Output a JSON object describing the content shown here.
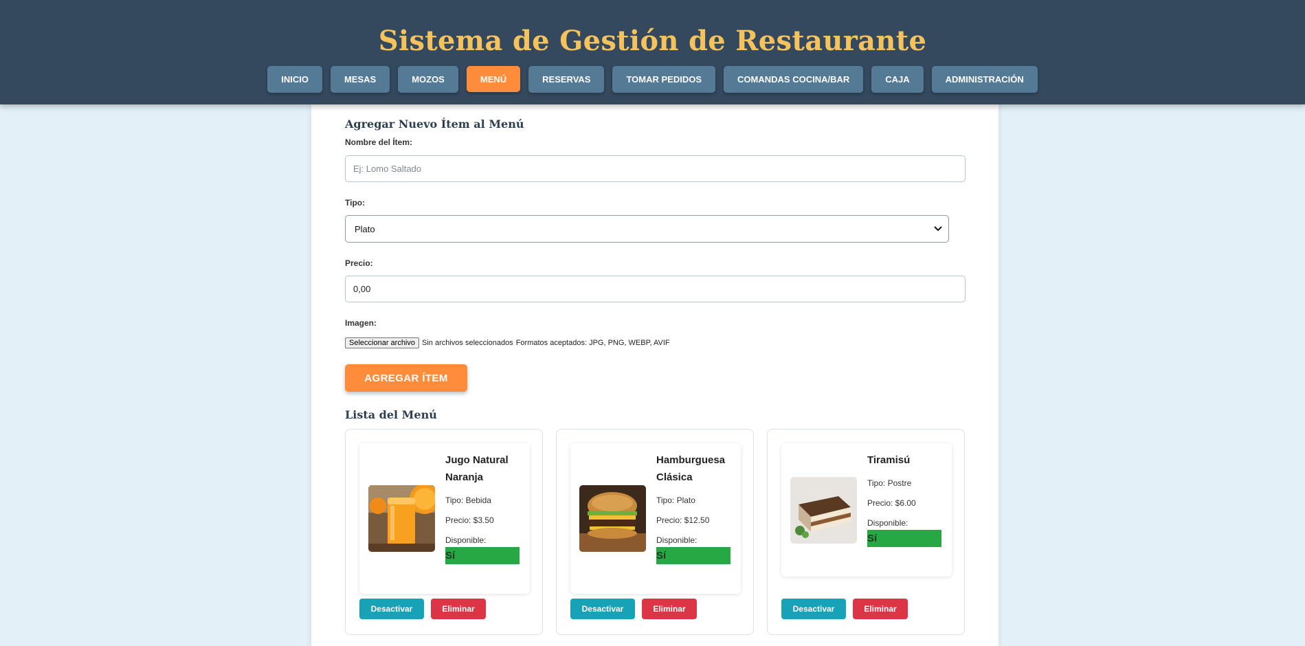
{
  "app": {
    "title": "Sistema de Gestión de Restaurante"
  },
  "nav": {
    "items": [
      {
        "label": "INICIO"
      },
      {
        "label": "MESAS"
      },
      {
        "label": "MOZOS"
      },
      {
        "label": "MENÚ",
        "active": true
      },
      {
        "label": "RESERVAS"
      },
      {
        "label": "TOMAR PEDIDOS"
      },
      {
        "label": "COMANDAS COCINA/BAR"
      },
      {
        "label": "CAJA"
      },
      {
        "label": "ADMINISTRACIÓN"
      }
    ]
  },
  "form": {
    "title": "Agregar Nuevo Ítem al Menú",
    "name_label": "Nombre del Ítem:",
    "name_placeholder": "Ej: Lomo Saltado",
    "type_label": "Tipo:",
    "type_value": "Plato",
    "price_label": "Precio:",
    "price_value": "0,00",
    "image_label": "Imagen:",
    "file_button": "Seleccionar archivo",
    "file_status": "Sin archivos seleccionados",
    "file_formats": "Formatos aceptados: JPG, PNG, WEBP, AVIF",
    "submit_label": "AGREGAR ÍTEM"
  },
  "menu_list": {
    "title": "Lista del Menú",
    "available_label": "Disponible:",
    "items": [
      {
        "name": "Jugo Natural Naranja",
        "type": "Tipo: Bebida",
        "price": "Precio: $3.50",
        "available": "Sí",
        "image": "orange-juice-photo"
      },
      {
        "name": "Hamburguesa Clásica",
        "type": "Tipo: Plato",
        "price": "Precio: $12.50",
        "available": "Sí",
        "image": "burger-photo"
      },
      {
        "name": "Tiramisú",
        "type": "Tipo: Postre",
        "price": "Precio: $6.00",
        "available": "Sí",
        "image": "tiramisu-photo"
      }
    ],
    "deactivate_label": "Desactivar",
    "delete_label": "Eliminar"
  },
  "colors": {
    "header_bg": "#34495e",
    "title": "#f6c25c",
    "nav_button": "#557a95",
    "accent": "#ff8c3b",
    "available": "#28a745",
    "deactivate": "#17a2b8",
    "delete": "#dc3545",
    "page_bg": "#e3f0f7"
  }
}
